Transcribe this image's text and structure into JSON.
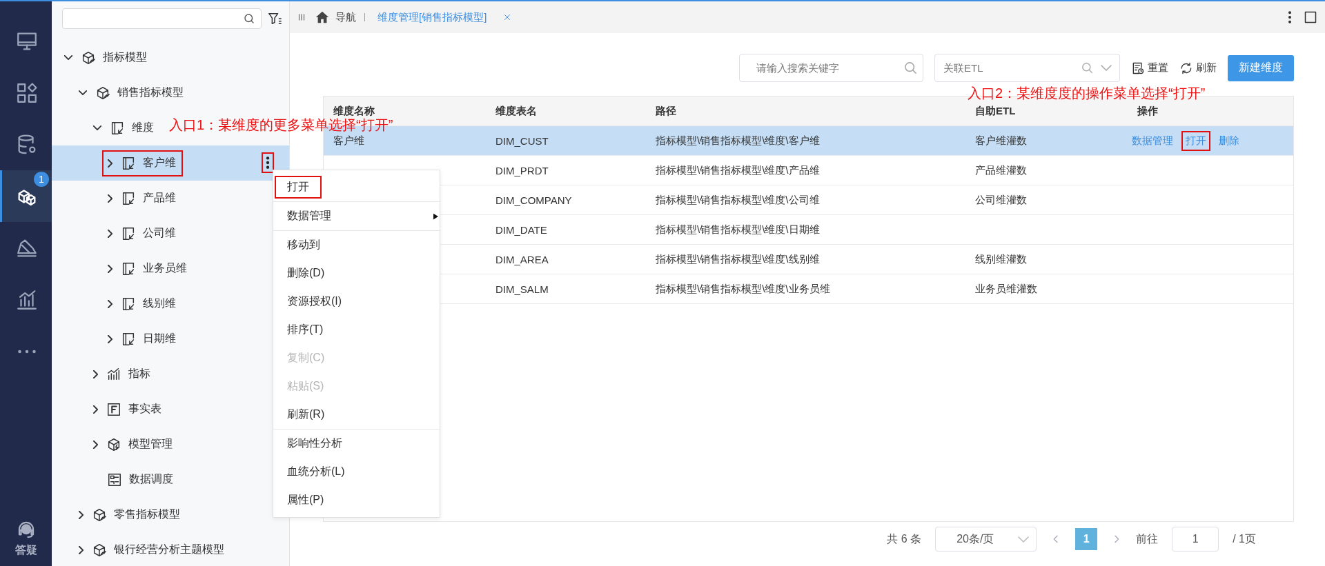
{
  "nav_rail": {
    "items": [
      {
        "kind": "monitor",
        "selected": false
      },
      {
        "kind": "apps",
        "selected": false
      },
      {
        "kind": "database",
        "selected": false
      },
      {
        "kind": "cubes",
        "selected": true,
        "badge": "1"
      },
      {
        "kind": "slope",
        "selected": false
      },
      {
        "kind": "chart",
        "selected": false
      },
      {
        "kind": "more",
        "selected": false
      }
    ],
    "help": {
      "label": "答疑"
    }
  },
  "tree": {
    "items": [
      {
        "label": "指标模型",
        "kind": "model",
        "expanded": true,
        "selected": false,
        "children": [
          {
            "label": "销售指标模型",
            "kind": "model",
            "expanded": true,
            "selected": false,
            "children": [
              {
                "label": "维度",
                "kind": "dimension",
                "expanded": true,
                "selected": false,
                "children": [
                  {
                    "label": "客户维",
                    "kind": "dimension",
                    "expanded": false,
                    "selected": true,
                    "marked": true,
                    "more_marked": true
                  },
                  {
                    "label": "产品维",
                    "kind": "dimension",
                    "expanded": false,
                    "selected": false
                  },
                  {
                    "label": "公司维",
                    "kind": "dimension",
                    "expanded": false,
                    "selected": false
                  },
                  {
                    "label": "业务员维",
                    "kind": "dimension",
                    "expanded": false,
                    "selected": false
                  },
                  {
                    "label": "线别维",
                    "kind": "dimension",
                    "expanded": false,
                    "selected": false
                  },
                  {
                    "label": "日期维",
                    "kind": "dimension",
                    "expanded": false,
                    "selected": false
                  }
                ]
              },
              {
                "label": "指标",
                "kind": "metric",
                "expanded": false,
                "selected": false
              },
              {
                "label": "事实表",
                "kind": "fact",
                "expanded": false,
                "selected": false
              },
              {
                "label": "模型管理",
                "kind": "manage",
                "expanded": false,
                "selected": false
              },
              {
                "label": "数据调度",
                "kind": "schedule",
                "selected": false
              }
            ]
          },
          {
            "label": "零售指标模型",
            "kind": "model",
            "expanded": false,
            "selected": false
          },
          {
            "label": "银行经营分析主题模型",
            "kind": "model",
            "expanded": false,
            "selected": false
          }
        ]
      }
    ]
  },
  "context_menu": {
    "items": [
      {
        "label": "打开",
        "disabled": false,
        "marked": true,
        "separator_after": true
      },
      {
        "label": "数据管理",
        "disabled": false,
        "submenu": true,
        "separator_after": true
      },
      {
        "label": "移动到",
        "disabled": false
      },
      {
        "label": "删除(D)",
        "disabled": false
      },
      {
        "label": "资源授权(I)",
        "disabled": false
      },
      {
        "label": "排序(T)",
        "disabled": false
      },
      {
        "label": "复制(C)",
        "disabled": true
      },
      {
        "label": "粘贴(S)",
        "disabled": true
      },
      {
        "label": "刷新(R)",
        "disabled": false,
        "separator_after": true
      },
      {
        "label": "影响性分析",
        "disabled": false
      },
      {
        "label": "血统分析(L)",
        "disabled": false
      },
      {
        "label": "属性(P)",
        "disabled": false
      }
    ]
  },
  "tab_bar": {
    "home_label": "导航",
    "tabs": [
      {
        "label": "维度管理[销售指标模型]",
        "selected": true
      }
    ]
  },
  "toolbar": {
    "search": {
      "placeholder": "请输入搜索关键字"
    },
    "etl_select": {
      "placeholder": "关联ETL"
    },
    "reset": "重置",
    "refresh": "刷新",
    "new_button": "新建维度"
  },
  "annotations": [
    {
      "text": "入口1：某维度的更多菜单选择“打开”"
    },
    {
      "text": "入口2：某维度度的操作菜单选择“打开”"
    }
  ],
  "table": {
    "columns": [
      "维度名称",
      "维度表名",
      "路径",
      "自助ETL",
      "操作"
    ],
    "rows": [
      {
        "name": "客户维",
        "table_name": "DIM_CUST",
        "path": "指标模型\\销售指标模型\\维度\\客户维",
        "etl": "客户维灌数",
        "selected": true,
        "actions": [
          {
            "label": "数据管理",
            "marked": false
          },
          {
            "label": "打开",
            "marked": true
          },
          {
            "label": "删除",
            "marked": false
          }
        ]
      },
      {
        "table_name": "DIM_PRDT",
        "path": "指标模型\\销售指标模型\\维度\\产品维",
        "etl": "产品维灌数",
        "selected": false
      },
      {
        "table_name": "DIM_COMPANY",
        "path": "指标模型\\销售指标模型\\维度\\公司维",
        "etl": "公司维灌数",
        "selected": false
      },
      {
        "table_name": "DIM_DATE",
        "path": "指标模型\\销售指标模型\\维度\\日期维",
        "selected": false
      },
      {
        "table_name": "DIM_AREA",
        "path": "指标模型\\销售指标模型\\维度\\线别维",
        "etl": "线别维灌数",
        "selected": false
      },
      {
        "table_name": "DIM_SALM",
        "path": "指标模型\\销售指标模型\\维度\\业务员维",
        "etl": "业务员维灌数",
        "selected": false
      }
    ]
  },
  "pagination": {
    "total": "共 6 条",
    "page_size": "20条/页",
    "pages": [
      {
        "label": "1",
        "selected": true
      }
    ],
    "goto_label": "前往",
    "goto_value": "1",
    "total_pages": "/ 1页"
  }
}
